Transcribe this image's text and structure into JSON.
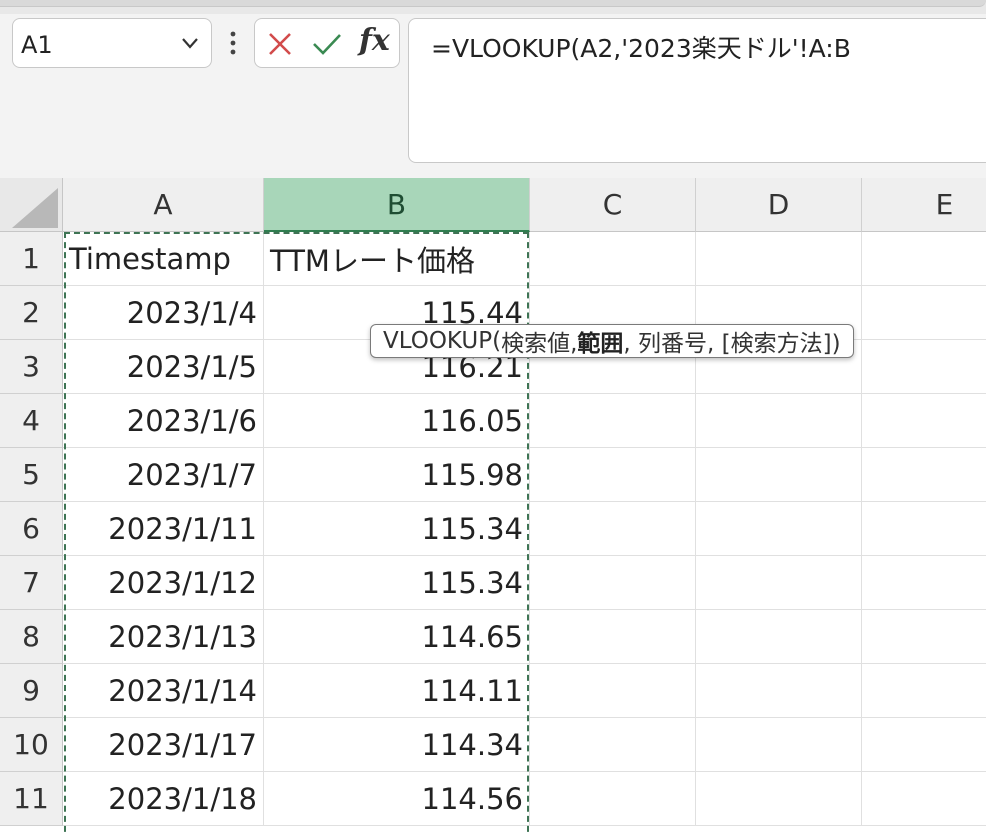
{
  "name_box": {
    "value": "A1"
  },
  "formula_bar": {
    "text": "=VLOOKUP(A2,'2023楽天ドル'!A:B"
  },
  "tooltip": {
    "func": "VLOOKUP(",
    "arg1": "検索値, ",
    "arg2_bold": "範囲",
    "rest": ", 列番号, [検索方法])"
  },
  "columns": [
    "A",
    "B",
    "C",
    "D",
    "E"
  ],
  "rows": [
    "1",
    "2",
    "3",
    "4",
    "5",
    "6",
    "7",
    "8",
    "9",
    "10",
    "11"
  ],
  "cells": [
    {
      "a": "Timestamp",
      "b": "TTMレート価格"
    },
    {
      "a": "2023/1/4",
      "b": "115.44"
    },
    {
      "a": "2023/1/5",
      "b": "116.21"
    },
    {
      "a": "2023/1/6",
      "b": "116.05"
    },
    {
      "a": "2023/1/7",
      "b": "115.98"
    },
    {
      "a": "2023/1/11",
      "b": "115.34"
    },
    {
      "a": "2023/1/12",
      "b": "115.34"
    },
    {
      "a": "2023/1/13",
      "b": "114.65"
    },
    {
      "a": "2023/1/14",
      "b": "114.11"
    },
    {
      "a": "2023/1/17",
      "b": "114.34"
    },
    {
      "a": "2023/1/18",
      "b": "114.56"
    }
  ],
  "colors": {
    "selected_header": "#a8d6b9",
    "marquee": "#3e7454",
    "cancel": "#d24b4b",
    "enter": "#3a8a52"
  }
}
